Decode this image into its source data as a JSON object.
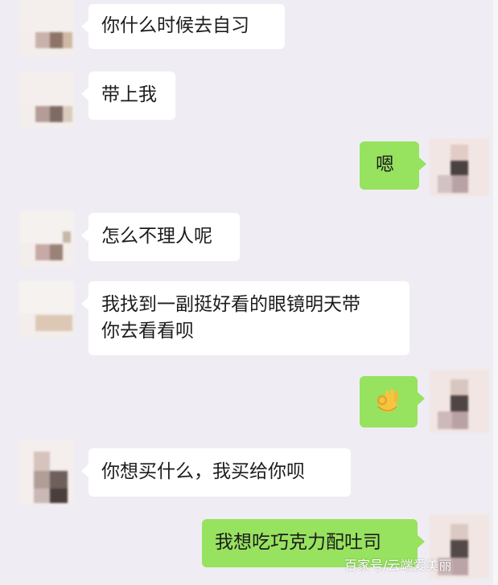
{
  "messages": [
    {
      "side": "left",
      "text": "你什么时候去自习"
    },
    {
      "side": "left",
      "text": "带上我"
    },
    {
      "side": "right",
      "text": "嗯"
    },
    {
      "side": "left",
      "text": "怎么不理人呢"
    },
    {
      "side": "left",
      "lines": [
        "我找到一副挺好看的眼镜明天带",
        "你去看看呗"
      ]
    },
    {
      "side": "right",
      "emoji": "ok-hand-icon"
    },
    {
      "side": "left",
      "text": "你想买什么，我买给你呗"
    },
    {
      "side": "right",
      "text": "我想吃巧克力配吐司"
    }
  ],
  "watermark": "百家号/云端爱美丽",
  "colors": {
    "background": "#efedf3",
    "incoming_bubble": "#ffffff",
    "outgoing_bubble": "#97e25f",
    "text": "#1c1c1c"
  }
}
